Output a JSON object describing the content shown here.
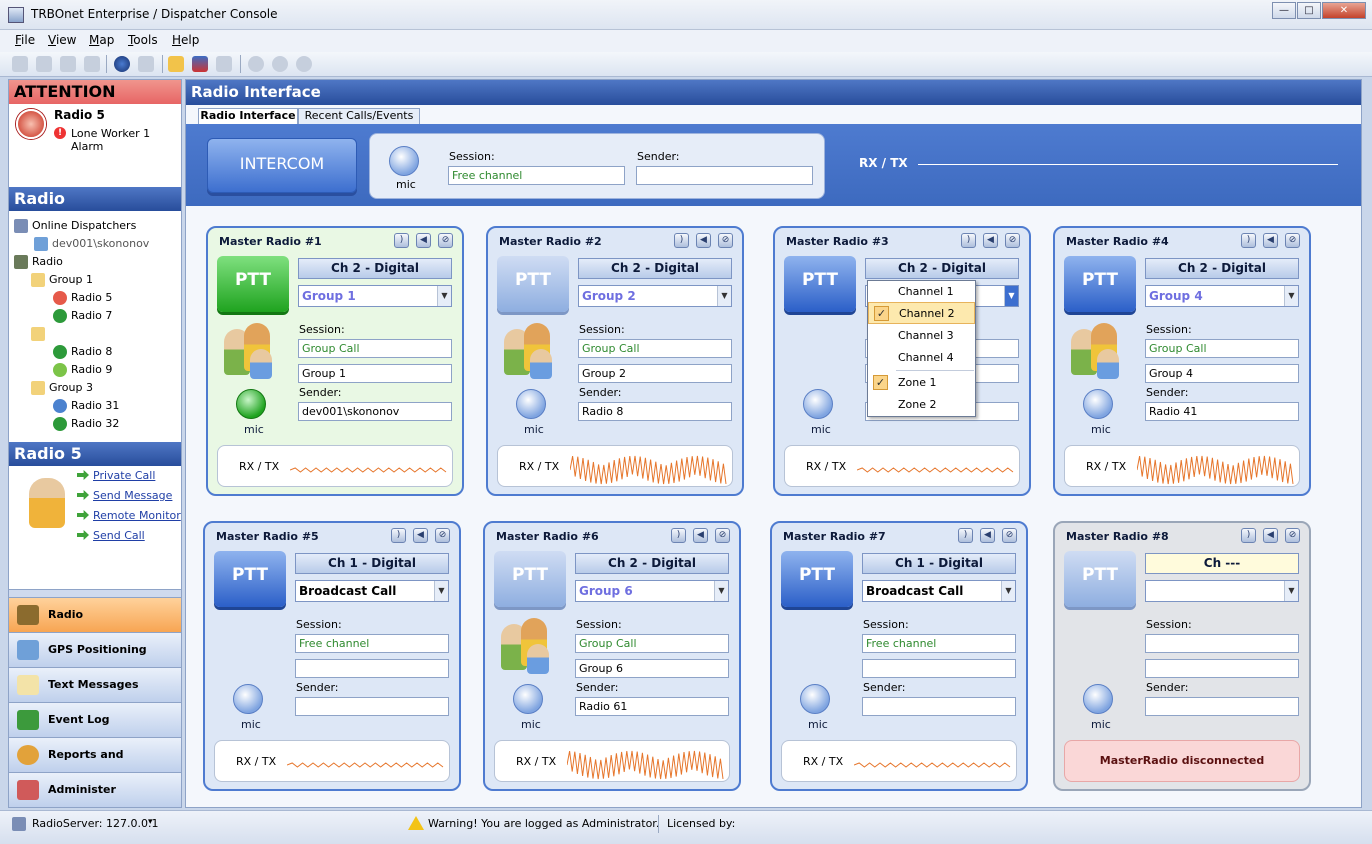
{
  "window": {
    "title": "TRBOnet Enterprise / Dispatcher Console"
  },
  "menu": [
    "File",
    "View",
    "Map",
    "Tools",
    "Help"
  ],
  "attention": {
    "header": "ATTENTION",
    "radio": "Radio 5",
    "alarm": "Lone Worker 1 Alarm"
  },
  "radio_panel": {
    "header": "Radio",
    "tree": [
      {
        "label": "Online Dispatchers"
      },
      {
        "label": "dev001\\skononov"
      },
      {
        "label": "Radio"
      },
      {
        "label": "Group 1"
      },
      {
        "label": "Radio 5"
      },
      {
        "label": "Radio 7"
      },
      {
        "label": ""
      },
      {
        "label": "Radio 8"
      },
      {
        "label": "Radio 9"
      },
      {
        "label": "Group 3"
      },
      {
        "label": "Radio 31"
      },
      {
        "label": "Radio 32"
      }
    ]
  },
  "radio5": {
    "header": "Radio 5",
    "actions": [
      "Private Call",
      "Send Message",
      "Remote Monitor",
      "Send Call"
    ]
  },
  "nav": [
    "Radio",
    "GPS Positioning",
    "Text Messages",
    "Event Log",
    "Reports and Statistics",
    "Administer"
  ],
  "main": {
    "header": "Radio Interface",
    "tabs": [
      "Radio Interface",
      "Recent Calls/Events"
    ],
    "intercom": "INTERCOM",
    "session_label": "Session:",
    "session_value": "Free channel",
    "sender_label": "Sender:",
    "sender_value": "",
    "mic": "mic",
    "rxtx": "RX / TX"
  },
  "cards": [
    {
      "title": "Master Radio #1",
      "ptt": "PTT",
      "channel": "Ch 2 - Digital",
      "group": "Group 1",
      "session_label": "Session:",
      "session": "Group Call",
      "talkgroup": "Group 1",
      "sender_label": "Sender:",
      "sender": "dev001\\skononov",
      "mic": "mic",
      "rxtx": "RX / TX"
    },
    {
      "title": "Master Radio #2",
      "ptt": "PTT",
      "channel": "Ch 2 - Digital",
      "group": "Group 2",
      "session_label": "Session:",
      "session": "Group Call",
      "talkgroup": "Group 2",
      "sender_label": "Sender:",
      "sender": "Radio 8",
      "mic": "mic",
      "rxtx": "RX / TX"
    },
    {
      "title": "Master Radio #3",
      "ptt": "PTT",
      "channel": "Ch 2 - Digital",
      "group": "",
      "session_label": "",
      "session": "",
      "talkgroup": "",
      "sender_label": "",
      "sender": "",
      "mic": "mic",
      "rxtx": "RX / TX"
    },
    {
      "title": "Master Radio #4",
      "ptt": "PTT",
      "channel": "Ch 2 - Digital",
      "group": "Group 4",
      "session_label": "Session:",
      "session": "Group Call",
      "talkgroup": "Group 4",
      "sender_label": "Sender:",
      "sender": "Radio 41",
      "mic": "mic",
      "rxtx": "RX / TX"
    },
    {
      "title": "Master Radio #5",
      "ptt": "PTT",
      "channel": "Ch 1 - Digital",
      "group": "Broadcast Call",
      "session_label": "Session:",
      "session": "Free channel",
      "talkgroup": "",
      "sender_label": "Sender:",
      "sender": "",
      "mic": "mic",
      "rxtx": "RX / TX"
    },
    {
      "title": "Master Radio #6",
      "ptt": "PTT",
      "channel": "Ch 2 - Digital",
      "group": "Group 6",
      "session_label": "Session:",
      "session": "Group Call",
      "talkgroup": "Group 6",
      "sender_label": "Sender:",
      "sender": "Radio 61",
      "mic": "mic",
      "rxtx": "RX / TX"
    },
    {
      "title": "Master Radio #7",
      "ptt": "PTT",
      "channel": "Ch 1 - Digital",
      "group": "Broadcast Call",
      "session_label": "Session:",
      "session": "Free channel",
      "talkgroup": "",
      "sender_label": "Sender:",
      "sender": "",
      "mic": "mic",
      "rxtx": "RX / TX"
    },
    {
      "title": "Master Radio #8",
      "ptt": "PTT",
      "channel": "Ch ---",
      "group": "",
      "session_label": "Session:",
      "session": "",
      "talkgroup": "",
      "sender_label": "Sender:",
      "sender": "",
      "mic": "mic",
      "status": "MasterRadio disconnected"
    }
  ],
  "dropdown": {
    "items": [
      "Channel 1",
      "Channel 2",
      "Channel 3",
      "Channel 4",
      "Zone 1",
      "Zone 2"
    ],
    "checked": [
      "Channel 2",
      "Zone 1"
    ]
  },
  "status": {
    "server": "RadioServer: 127.0.0.1",
    "warning": "Warning! You are logged as Administrator.",
    "licensed": "Licensed by:"
  },
  "colors": {
    "accent": "#284d9b",
    "ptt_active": "#1fa31f",
    "attention": "#e76565"
  }
}
